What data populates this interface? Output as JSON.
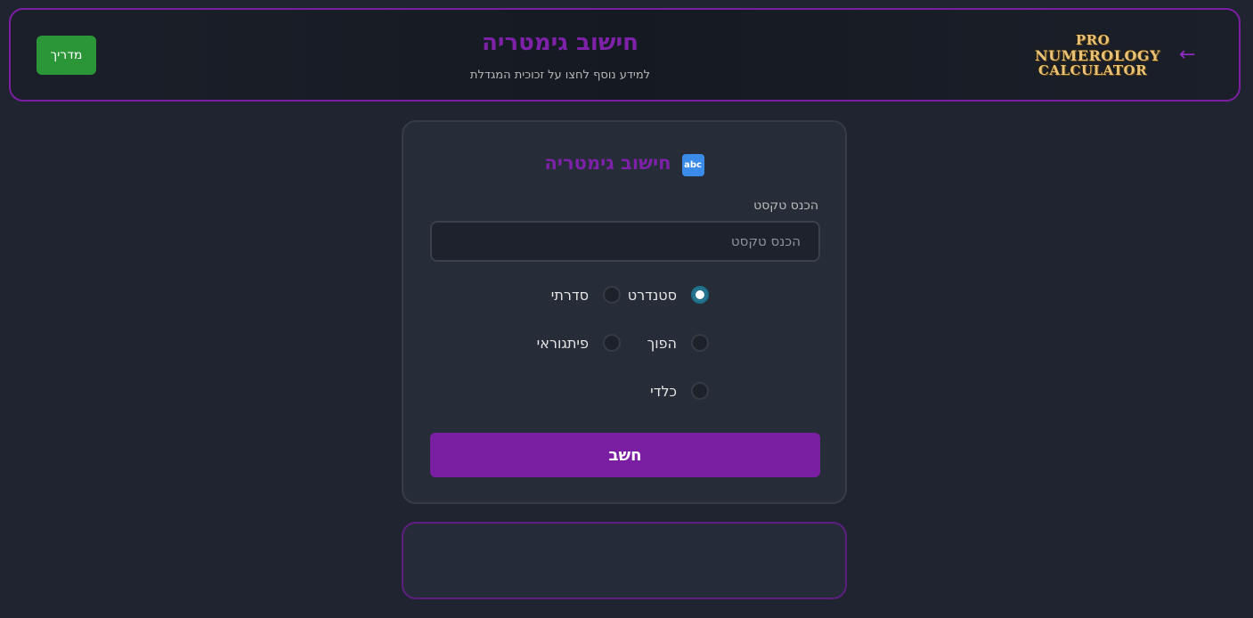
{
  "header": {
    "title": "חישוב גימטריה",
    "subtitle": "למידע נוסף לחצו על זכוכית המגדלת",
    "guide_label": "מדריך",
    "back_icon": "←",
    "logo": {
      "line1": "PRO",
      "line2": "NUMEROLOGY",
      "line3": "CALCULATOR"
    }
  },
  "card": {
    "icon": "abc",
    "title": "חישוב גימטריה",
    "input_label": "הכנס טקסט",
    "input_placeholder": "הכנס טקסט",
    "input_value": "",
    "options": [
      {
        "label": "סטנדרט",
        "checked": true
      },
      {
        "label": "סדרתי",
        "checked": false
      },
      {
        "label": "הפוך",
        "checked": false
      },
      {
        "label": "פיתגוראי",
        "checked": false
      },
      {
        "label": "כלדי",
        "checked": false
      }
    ],
    "calculate_label": "חשב"
  },
  "colors": {
    "accent": "#7a1fa2",
    "guide_button": "#2a9638",
    "background": "#1f2430",
    "card": "#262c38",
    "logo_gold": "#e8c277"
  }
}
